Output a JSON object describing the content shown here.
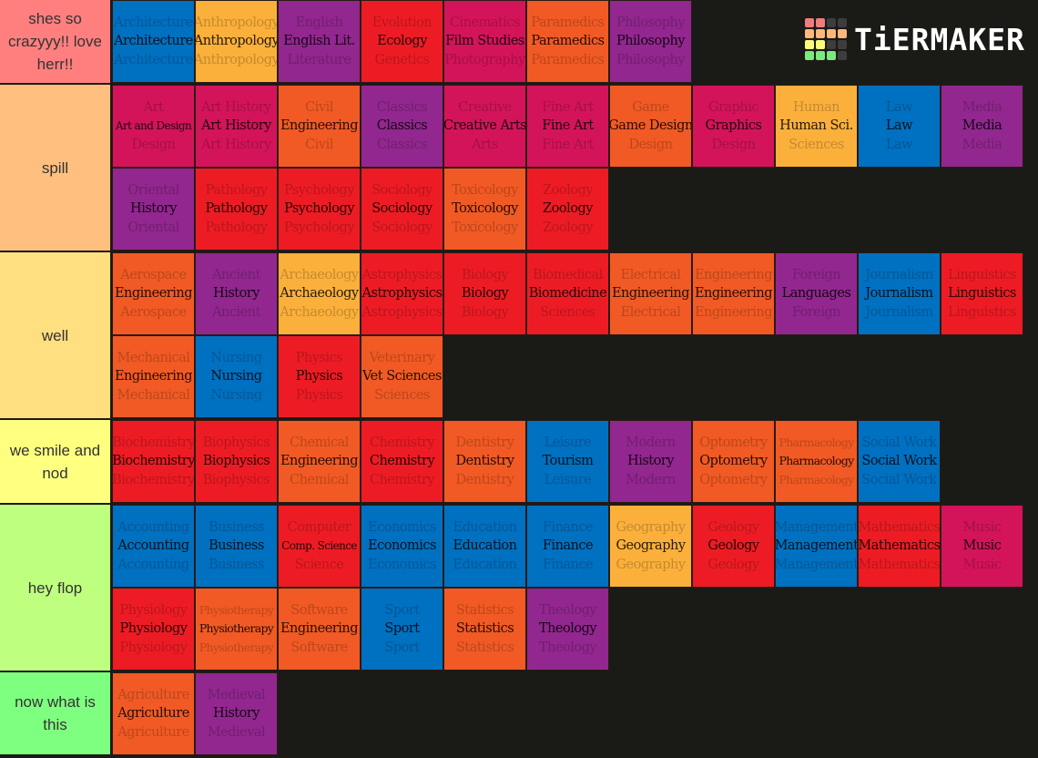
{
  "logo": {
    "text": "TiERMAKER",
    "grid_colors": [
      [
        "#f07c7c",
        "#f07c7c",
        "#3d3d3d",
        "#3d3d3d"
      ],
      [
        "#ffb77a",
        "#ffb77a",
        "#ffb77a",
        "#ffb77a"
      ],
      [
        "#fdfd7a",
        "#fdfd7a",
        "#3d3d3d",
        "#3d3d3d"
      ],
      [
        "#7ce97c",
        "#7ce97c",
        "#7ce97c",
        "#3d3d3d"
      ]
    ]
  },
  "colors": {
    "blue": "#0070c0",
    "yellow": "#fbb03b",
    "purple": "#92278f",
    "red": "#ed1c24",
    "pink": "#d4145a",
    "orange": "#f15a24"
  },
  "tiers": [
    {
      "label": "shes so crazyyy!! love herr!!",
      "color": "#ff7f7f",
      "items": [
        {
          "top": "Architecture",
          "mid": "Architecture",
          "bot": "Architecture",
          "color": "blue"
        },
        {
          "top": "Anthropology",
          "mid": "Anthropology",
          "bot": "Anthropology",
          "color": "yellow"
        },
        {
          "top": "English",
          "mid": "English Lit.",
          "bot": "Literature",
          "color": "purple"
        },
        {
          "top": "Evolution",
          "mid": "Ecology",
          "bot": "Genetics",
          "color": "red"
        },
        {
          "top": "Cinematics",
          "mid": "Film Studies",
          "bot": "Photography",
          "color": "pink"
        },
        {
          "top": "Paramedics",
          "mid": "Paramedics",
          "bot": "Paramedics",
          "color": "orange"
        },
        {
          "top": "Philosophy",
          "mid": "Philosophy",
          "bot": "Philosophy",
          "color": "purple"
        }
      ]
    },
    {
      "label": "spill",
      "color": "#ffbf7f",
      "items": [
        {
          "top": "Art",
          "mid": "Art and Design",
          "bot": "Design",
          "color": "pink",
          "size": "sm"
        },
        {
          "top": "Art History",
          "mid": "Art History",
          "bot": "Art History",
          "color": "pink"
        },
        {
          "top": "Civil",
          "mid": "Engineering",
          "bot": "Civil",
          "color": "orange"
        },
        {
          "top": "Classics",
          "mid": "Classics",
          "bot": "Classics",
          "color": "purple"
        },
        {
          "top": "Creative",
          "mid": "Creative Arts",
          "bot": "Arts",
          "color": "pink"
        },
        {
          "top": "Fine Art",
          "mid": "Fine Art",
          "bot": "Fine Art",
          "color": "pink"
        },
        {
          "top": "Game",
          "mid": "Game Design",
          "bot": "Design",
          "color": "orange"
        },
        {
          "top": "Graphic",
          "mid": "Graphics",
          "bot": "Design",
          "color": "pink"
        },
        {
          "top": "Human",
          "mid": "Human Sci.",
          "bot": "Sciences",
          "color": "yellow"
        },
        {
          "top": "Law",
          "mid": "Law",
          "bot": "Law",
          "color": "blue"
        },
        {
          "top": "Media",
          "mid": "Media",
          "bot": "Media",
          "color": "purple"
        },
        {
          "top": "Oriental",
          "mid": "History",
          "bot": "Oriental",
          "color": "purple"
        },
        {
          "top": "Pathology",
          "mid": "Pathology",
          "bot": "Pathology",
          "color": "red"
        },
        {
          "top": "Psychology",
          "mid": "Psychology",
          "bot": "Psychology",
          "color": "red"
        },
        {
          "top": "Sociology",
          "mid": "Sociology",
          "bot": "Sociology",
          "color": "red"
        },
        {
          "top": "Toxicology",
          "mid": "Toxicology",
          "bot": "Toxicology",
          "color": "orange"
        },
        {
          "top": "Zoology",
          "mid": "Zoology",
          "bot": "Zoology",
          "color": "red"
        }
      ]
    },
    {
      "label": "well",
      "color": "#ffdf7f",
      "items": [
        {
          "top": "Aerospace",
          "mid": "Engineering",
          "bot": "Aerospace",
          "color": "orange"
        },
        {
          "top": "Ancient",
          "mid": "History",
          "bot": "Ancient",
          "color": "purple"
        },
        {
          "top": "Archaeology",
          "mid": "Archaeology",
          "bot": "Archaeology",
          "color": "yellow"
        },
        {
          "top": "Astrophysics",
          "mid": "Astrophysics",
          "bot": "Astrophysics",
          "color": "red"
        },
        {
          "top": "Biology",
          "mid": "Biology",
          "bot": "Biology",
          "color": "red"
        },
        {
          "top": "Biomedical",
          "mid": "Biomedicine",
          "bot": "Sciences",
          "color": "red"
        },
        {
          "top": "Electrical",
          "mid": "Engineering",
          "bot": "Electrical",
          "color": "orange"
        },
        {
          "top": "Engineering",
          "mid": "Engineering",
          "bot": "Engineering",
          "color": "orange"
        },
        {
          "top": "Foreign",
          "mid": "Languages",
          "bot": "Foreign",
          "color": "purple"
        },
        {
          "top": "Journalism",
          "mid": "Journalism",
          "bot": "Journalism",
          "color": "blue"
        },
        {
          "top": "Linguistics",
          "mid": "Linguistics",
          "bot": "Linguistics",
          "color": "red"
        },
        {
          "top": "Mechanical",
          "mid": "Engineering",
          "bot": "Mechanical",
          "color": "orange"
        },
        {
          "top": "Nursing",
          "mid": "Nursing",
          "bot": "Nursing",
          "color": "blue"
        },
        {
          "top": "Physics",
          "mid": "Physics",
          "bot": "Physics",
          "color": "red"
        },
        {
          "top": "Veterinary",
          "mid": "Vet Sciences",
          "bot": "Sciences",
          "color": "orange"
        }
      ]
    },
    {
      "label": "we smile and nod",
      "color": "#ffff7f",
      "items": [
        {
          "top": "Biochemistry",
          "mid": "Biochemistry",
          "bot": "Biochemistry",
          "color": "red"
        },
        {
          "top": "Biophysics",
          "mid": "Biophysics",
          "bot": "Biophysics",
          "color": "red"
        },
        {
          "top": "Chemical",
          "mid": "Engineering",
          "bot": "Chemical",
          "color": "orange"
        },
        {
          "top": "Chemistry",
          "mid": "Chemistry",
          "bot": "Chemistry",
          "color": "red"
        },
        {
          "top": "Dentistry",
          "mid": "Dentistry",
          "bot": "Dentistry",
          "color": "orange"
        },
        {
          "top": "Leisure",
          "mid": "Tourism",
          "bot": "Leisure",
          "color": "blue"
        },
        {
          "top": "Modern",
          "mid": "History",
          "bot": "Modern",
          "color": "purple"
        },
        {
          "top": "Optometry",
          "mid": "Optometry",
          "bot": "Optometry",
          "color": "orange"
        },
        {
          "top": "Pharmacology",
          "mid": "Pharmacology",
          "bot": "Pharmacology",
          "color": "orange",
          "size": "xs"
        },
        {
          "top": "Social Work",
          "mid": "Social Work",
          "bot": "Social Work",
          "color": "blue"
        }
      ]
    },
    {
      "label": "hey flop",
      "color": "#bfff7f",
      "items": [
        {
          "top": "Accounting",
          "mid": "Accounting",
          "bot": "Accounting",
          "color": "blue"
        },
        {
          "top": "Business",
          "mid": "Business",
          "bot": "Business",
          "color": "blue"
        },
        {
          "top": "Computer",
          "mid": "Comp. Science",
          "bot": "Science",
          "color": "red",
          "size": "sm"
        },
        {
          "top": "Economics",
          "mid": "Economics",
          "bot": "Economics",
          "color": "blue"
        },
        {
          "top": "Education",
          "mid": "Education",
          "bot": "Education",
          "color": "blue"
        },
        {
          "top": "Finance",
          "mid": "Finance",
          "bot": "Finance",
          "color": "blue"
        },
        {
          "top": "Geography",
          "mid": "Geography",
          "bot": "Geography",
          "color": "yellow"
        },
        {
          "top": "Geology",
          "mid": "Geology",
          "bot": "Geology",
          "color": "red"
        },
        {
          "top": "Management",
          "mid": "Management",
          "bot": "Management",
          "color": "blue"
        },
        {
          "top": "Mathematics",
          "mid": "Mathematics",
          "bot": "Mathematics",
          "color": "red"
        },
        {
          "top": "Music",
          "mid": "Music",
          "bot": "Music",
          "color": "pink"
        },
        {
          "top": "Physiology",
          "mid": "Physiology",
          "bot": "Physiology",
          "color": "red"
        },
        {
          "top": "Physiotherapy",
          "mid": "Physiotherapy",
          "bot": "Physiotherapy",
          "color": "orange",
          "size": "xs"
        },
        {
          "top": "Software",
          "mid": "Engineering",
          "bot": "Software",
          "color": "orange"
        },
        {
          "top": "Sport",
          "mid": "Sport",
          "bot": "Sport",
          "color": "blue"
        },
        {
          "top": "Statistics",
          "mid": "Statistics",
          "bot": "Statistics",
          "color": "orange"
        },
        {
          "top": "Theology",
          "mid": "Theology",
          "bot": "Theology",
          "color": "purple"
        }
      ]
    },
    {
      "label": "now what is this",
      "color": "#7fff7f",
      "items": [
        {
          "top": "Agriculture",
          "mid": "Agriculture",
          "bot": "Agriculture",
          "color": "orange"
        },
        {
          "top": "Medieval",
          "mid": "History",
          "bot": "Medieval",
          "color": "purple"
        }
      ]
    }
  ]
}
